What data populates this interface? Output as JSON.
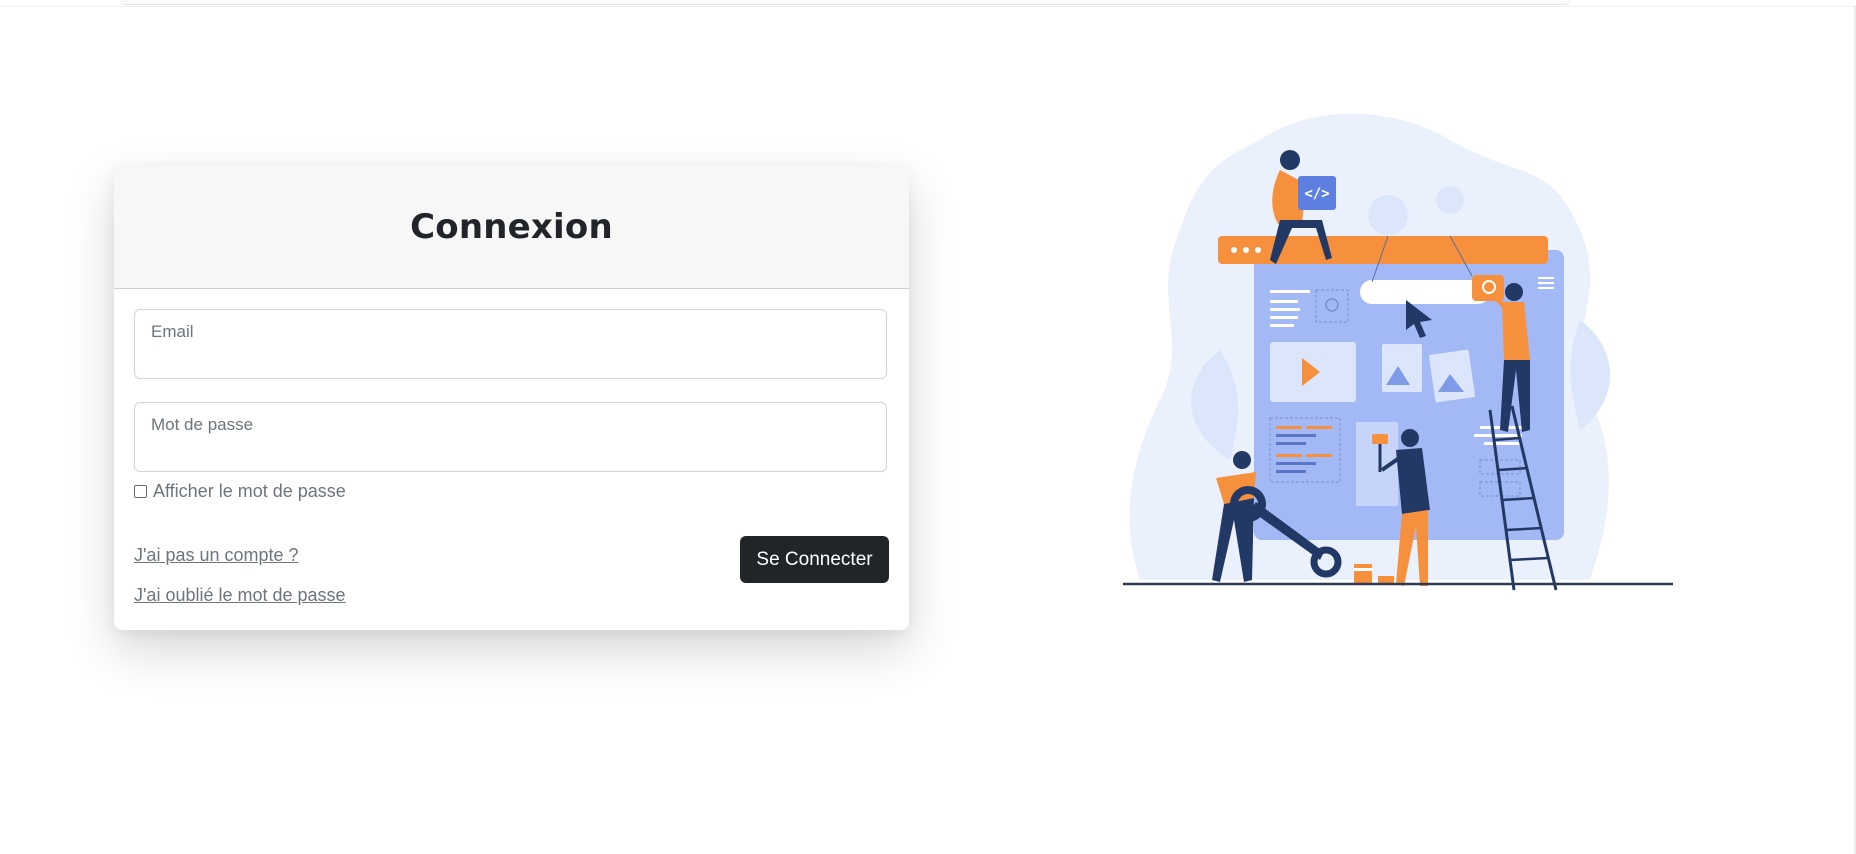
{
  "login": {
    "title": "Connexion",
    "email_label": "Email",
    "email_value": "",
    "password_label": "Mot de passe",
    "password_value": "",
    "show_password_label": "Afficher le mot de passe",
    "show_password_checked": false,
    "register_link": "J'ai pas un compte ?",
    "forgot_link": "J'ai oublié le mot de passe",
    "submit_label": "Se Connecter"
  },
  "illustration": {
    "code_tag_text": "</>",
    "colors": {
      "blob": "#e8f0fc",
      "screen": "#a3b9f5",
      "orange": "#f7903d",
      "navy": "#223966",
      "ground": "#2a3b55"
    }
  }
}
